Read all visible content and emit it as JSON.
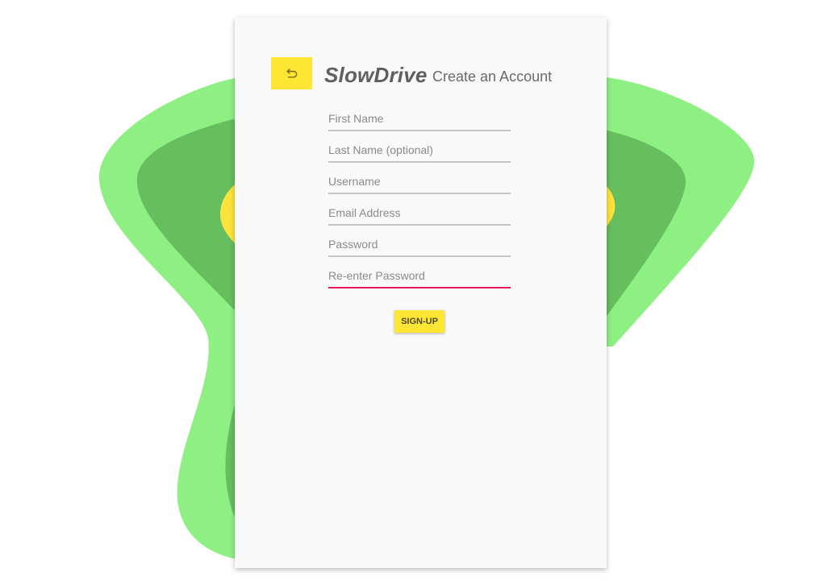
{
  "app": {
    "brand": "SlowDrive",
    "subtitle": "Create an Account"
  },
  "back_button": {
    "icon": "back-arrow-icon"
  },
  "form": {
    "fields": [
      {
        "placeholder": "First Name",
        "value": ""
      },
      {
        "placeholder": "Last Name (optional)",
        "value": ""
      },
      {
        "placeholder": "Username",
        "value": ""
      },
      {
        "placeholder": "Email Address",
        "value": ""
      },
      {
        "placeholder": "Password",
        "value": ""
      },
      {
        "placeholder": "Re-enter Password",
        "value": "",
        "focused": true
      }
    ],
    "submit_label": "SIGN-UP"
  },
  "colors": {
    "accent_yellow": "#ffe635",
    "blob_light_green": "#8ef083",
    "blob_dark_green": "#66be5e",
    "blob_yellow": "#ffe33c",
    "focus_underline": "#e8175d",
    "card_bg": "#f9f9f9"
  }
}
